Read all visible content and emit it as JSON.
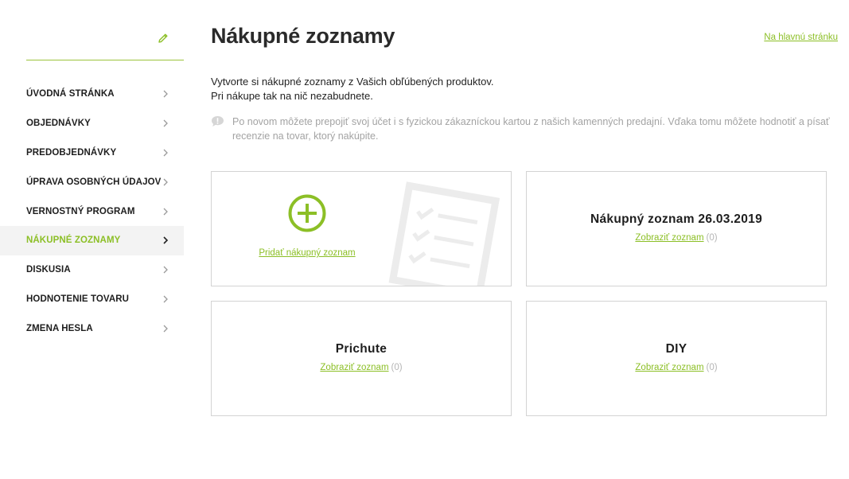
{
  "sidebar": {
    "items": [
      {
        "label": "ÚVODNÁ STRÁNKA",
        "active": false
      },
      {
        "label": "OBJEDNÁVKY",
        "active": false
      },
      {
        "label": "PREDOBJEDNÁVKY",
        "active": false
      },
      {
        "label": "ÚPRAVA OSOBNÝCH ÚDAJOV",
        "active": false
      },
      {
        "label": "VERNOSTNÝ PROGRAM",
        "active": false
      },
      {
        "label": "NÁKUPNÉ ZOZNAMY",
        "active": true
      },
      {
        "label": "DISKUSIA",
        "active": false
      },
      {
        "label": "HODNOTENIE TOVARU",
        "active": false
      },
      {
        "label": "ZMENA HESLA",
        "active": false
      }
    ]
  },
  "header": {
    "title": "Nákupné zoznamy",
    "home_link": "Na hlavnú stránku"
  },
  "intro": {
    "line1": "Vytvorte si nákupné zoznamy z Vašich obľúbených produktov.",
    "line2": "Pri nákupe tak na nič nezabudnete."
  },
  "info": {
    "text": "Po novom môžete prepojiť svoj účet i s fyzickou zákazníckou kartou z našich kamenných predajní. Vďaka tomu môžete hodnotiť a písať recenzie na tovar, ktorý nakúpite."
  },
  "add_card": {
    "label": "Pridať nákupný zoznam"
  },
  "lists": [
    {
      "name": "Nákupný zoznam 26.03.2019",
      "link": "Zobraziť zoznam",
      "count": "(0)"
    },
    {
      "name": "Prichute",
      "link": "Zobraziť zoznam",
      "count": "(0)"
    },
    {
      "name": "DIY",
      "link": "Zobraziť zoznam",
      "count": "(0)"
    }
  ],
  "colors": {
    "accent": "#8cbf26",
    "muted": "#a3a3a3",
    "border": "#d3d3d3"
  },
  "icons": {
    "edit": "pencil-icon",
    "chevron": "chevron-right-icon",
    "info": "info-speech-icon",
    "add": "plus-circle-icon",
    "decor": "checklist-icon"
  }
}
